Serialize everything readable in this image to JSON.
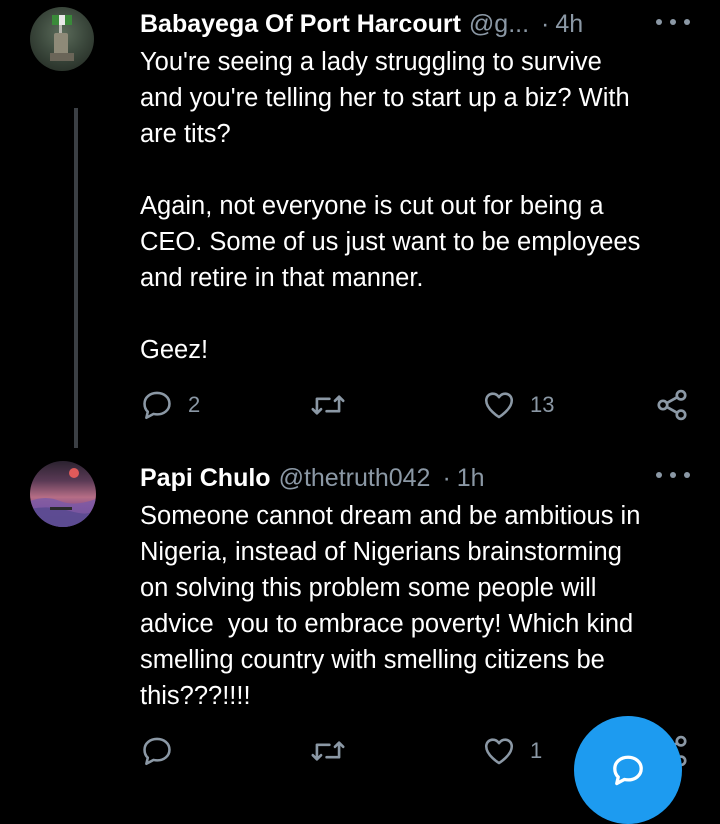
{
  "tweets": [
    {
      "display_name": "Babayega Of Port Harcourt",
      "handle": "@g...",
      "separator": "·",
      "time": "4h",
      "text": "You're seeing a lady struggling to survive\nand you're telling her to start up a biz? With\nare tits?\n\nAgain, not everyone is cut out for being a\nCEO. Some of us just want to be employees\nand retire in that manner.\n\nGeez!",
      "reply_count": "2",
      "retweet_count": "",
      "like_count": "13"
    },
    {
      "display_name": "Papi Chulo",
      "handle": "@thetruth042",
      "separator": "·",
      "time": "1h",
      "text": "Someone cannot dream and be ambitious in\nNigeria, instead of Nigerians brainstorming\non solving this problem some people will\nadvice  you to embrace poverty! Which kind\nsmelling country with smelling citizens be\nthis???!!!!",
      "reply_count": "",
      "retweet_count": "",
      "like_count": "1"
    }
  ],
  "icons": {
    "reply": "reply-icon",
    "retweet": "retweet-icon",
    "like": "heart-icon",
    "share": "share-icon",
    "more": "more-icon",
    "compose": "compose-icon"
  },
  "colors": {
    "background": "#000000",
    "text": "#ffffff",
    "muted": "#8b98a5",
    "accent": "#1d9bf0",
    "thread_line": "#3b3f44"
  }
}
